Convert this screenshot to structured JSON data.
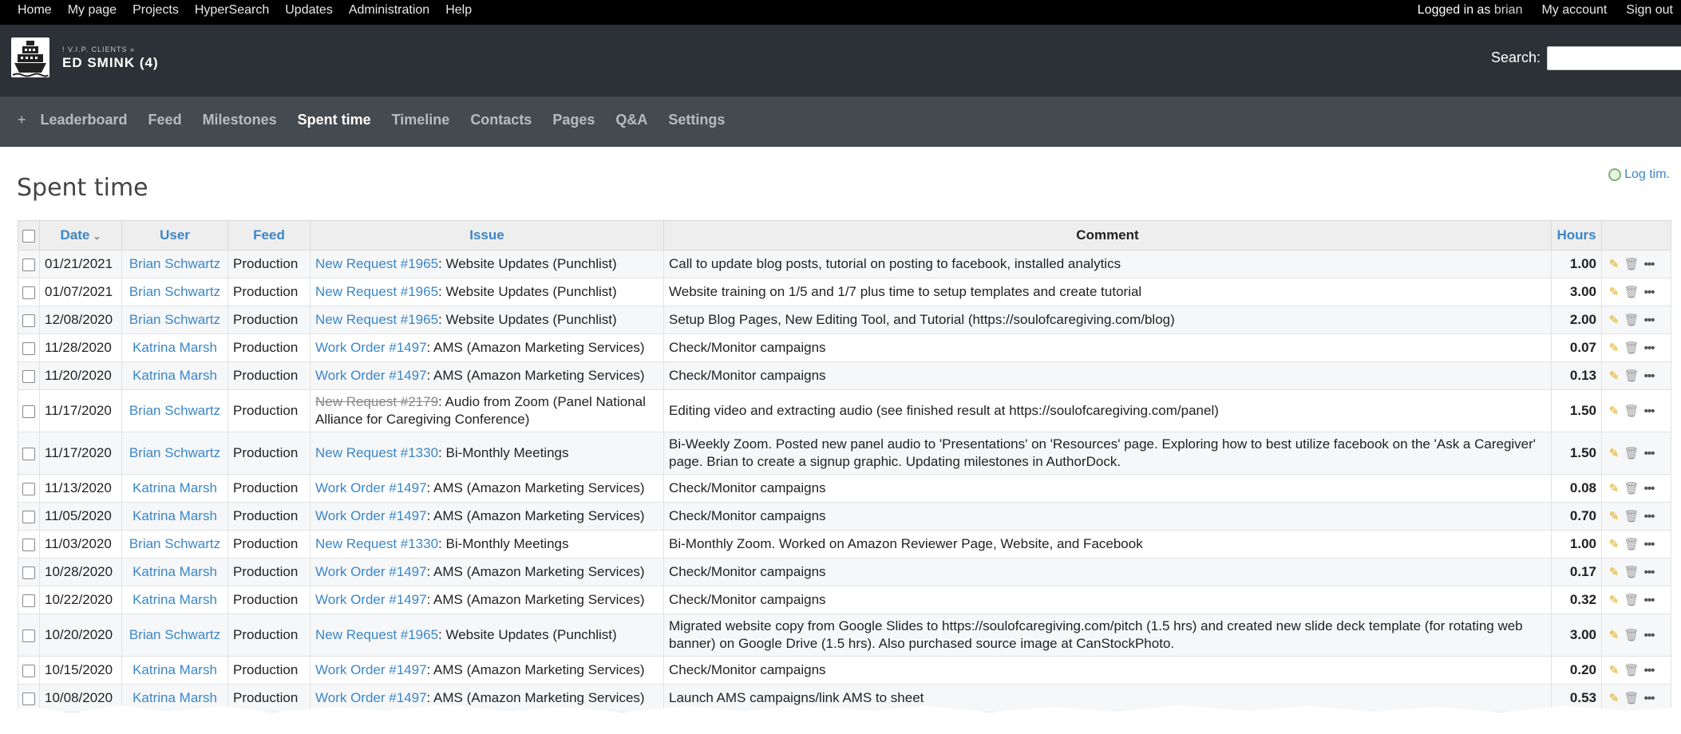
{
  "top_menu": {
    "left": [
      "Home",
      "My page",
      "Projects",
      "HyperSearch",
      "Updates",
      "Administration",
      "Help"
    ],
    "logged_as_label": "Logged in as",
    "logged_as_user": "brian",
    "my_account": "My account",
    "sign_out": "Sign out"
  },
  "header": {
    "parent": "! V.I.P. CLIENTS »",
    "project": "ED SMINK (4)",
    "search_label": "Search:",
    "search_value": ""
  },
  "main_menu": {
    "plus": "+",
    "items": [
      "Leaderboard",
      "Feed",
      "Milestones",
      "Spent time",
      "Timeline",
      "Contacts",
      "Pages",
      "Q&A",
      "Settings"
    ],
    "selected": "Spent time"
  },
  "page": {
    "title": "Spent time",
    "log_time": "Log tim."
  },
  "table": {
    "headers": {
      "date": "Date",
      "user": "User",
      "feed": "Feed",
      "issue": "Issue",
      "comment": "Comment",
      "hours": "Hours"
    },
    "rows": [
      {
        "date": "01/21/2021",
        "user": "Brian Schwartz",
        "feed": "Production",
        "issue_link": "New Request #1965",
        "issue_text": ": Website Updates (Punchlist)",
        "comment": "Call to update blog posts, tutorial on posting to facebook, installed analytics",
        "hours": "1.00"
      },
      {
        "date": "01/07/2021",
        "user": "Brian Schwartz",
        "feed": "Production",
        "issue_link": "New Request #1965",
        "issue_text": ": Website Updates (Punchlist)",
        "comment": "Website training on 1/5 and 1/7 plus time to setup templates and create tutorial",
        "hours": "3.00"
      },
      {
        "date": "12/08/2020",
        "user": "Brian Schwartz",
        "feed": "Production",
        "issue_link": "New Request #1965",
        "issue_text": ": Website Updates (Punchlist)",
        "comment": "Setup Blog Pages, New Editing Tool, and Tutorial (https://soulofcaregiving.com/blog)",
        "hours": "2.00"
      },
      {
        "date": "11/28/2020",
        "user": "Katrina Marsh",
        "feed": "Production",
        "issue_link": "Work Order #1497",
        "issue_text": ": AMS (Amazon Marketing Services)",
        "comment": "Check/Monitor campaigns",
        "hours": "0.07"
      },
      {
        "date": "11/20/2020",
        "user": "Katrina Marsh",
        "feed": "Production",
        "issue_link": "Work Order #1497",
        "issue_text": ": AMS (Amazon Marketing Services)",
        "comment": "Check/Monitor campaigns",
        "hours": "0.13"
      },
      {
        "date": "11/17/2020",
        "user": "Brian Schwartz",
        "feed": "Production",
        "issue_link": "New Request #2179",
        "issue_closed": true,
        "issue_text": ": Audio from Zoom (Panel National Alliance for Caregiving Conference)",
        "comment": "Editing video and extracting audio (see finished result at https://soulofcaregiving.com/panel)",
        "hours": "1.50"
      },
      {
        "date": "11/17/2020",
        "user": "Brian Schwartz",
        "feed": "Production",
        "issue_link": "New Request #1330",
        "issue_text": ": Bi-Monthly Meetings",
        "comment": "Bi-Weekly Zoom. Posted new panel audio to 'Presentations' on 'Resources' page. Exploring how to best utilize facebook on the 'Ask a Caregiver' page. Brian to create a signup graphic. Updating milestones in AuthorDock.",
        "hours": "1.50"
      },
      {
        "date": "11/13/2020",
        "user": "Katrina Marsh",
        "feed": "Production",
        "issue_link": "Work Order #1497",
        "issue_text": ": AMS (Amazon Marketing Services)",
        "comment": "Check/Monitor campaigns",
        "hours": "0.08"
      },
      {
        "date": "11/05/2020",
        "user": "Katrina Marsh",
        "feed": "Production",
        "issue_link": "Work Order #1497",
        "issue_text": ": AMS (Amazon Marketing Services)",
        "comment": "Check/Monitor campaigns",
        "hours": "0.70"
      },
      {
        "date": "11/03/2020",
        "user": "Brian Schwartz",
        "feed": "Production",
        "issue_link": "New Request #1330",
        "issue_text": ": Bi-Monthly Meetings",
        "comment": "Bi-Monthly Zoom. Worked on Amazon Reviewer Page, Website, and Facebook",
        "hours": "1.00"
      },
      {
        "date": "10/28/2020",
        "user": "Katrina Marsh",
        "feed": "Production",
        "issue_link": "Work Order #1497",
        "issue_text": ": AMS (Amazon Marketing Services)",
        "comment": "Check/Monitor campaigns",
        "hours": "0.17"
      },
      {
        "date": "10/22/2020",
        "user": "Katrina Marsh",
        "feed": "Production",
        "issue_link": "Work Order #1497",
        "issue_text": ": AMS (Amazon Marketing Services)",
        "comment": "Check/Monitor campaigns",
        "hours": "0.32"
      },
      {
        "date": "10/20/2020",
        "user": "Brian Schwartz",
        "feed": "Production",
        "issue_link": "New Request #1965",
        "issue_text": ": Website Updates (Punchlist)",
        "comment": "Migrated website copy from Google Slides to https://soulofcaregiving.com/pitch (1.5 hrs) and created new slide deck template (for rotating web banner) on Google Drive (1.5 hrs). Also purchased source image at CanStockPhoto.",
        "hours": "3.00"
      },
      {
        "date": "10/15/2020",
        "user": "Katrina Marsh",
        "feed": "Production",
        "issue_link": "Work Order #1497",
        "issue_text": ": AMS (Amazon Marketing Services)",
        "comment": "Check/Monitor campaigns",
        "hours": "0.20"
      },
      {
        "date": "10/08/2020",
        "user": "Katrina Marsh",
        "feed": "Production",
        "issue_link": "Work Order #1497",
        "issue_text": ": AMS (Amazon Marketing Services)",
        "comment": "Launch AMS campaigns/link AMS to sheet",
        "hours": "0.53"
      }
    ]
  },
  "icons": {
    "edit": "pencil-icon",
    "delete": "trash-icon",
    "more": "more-icon"
  }
}
